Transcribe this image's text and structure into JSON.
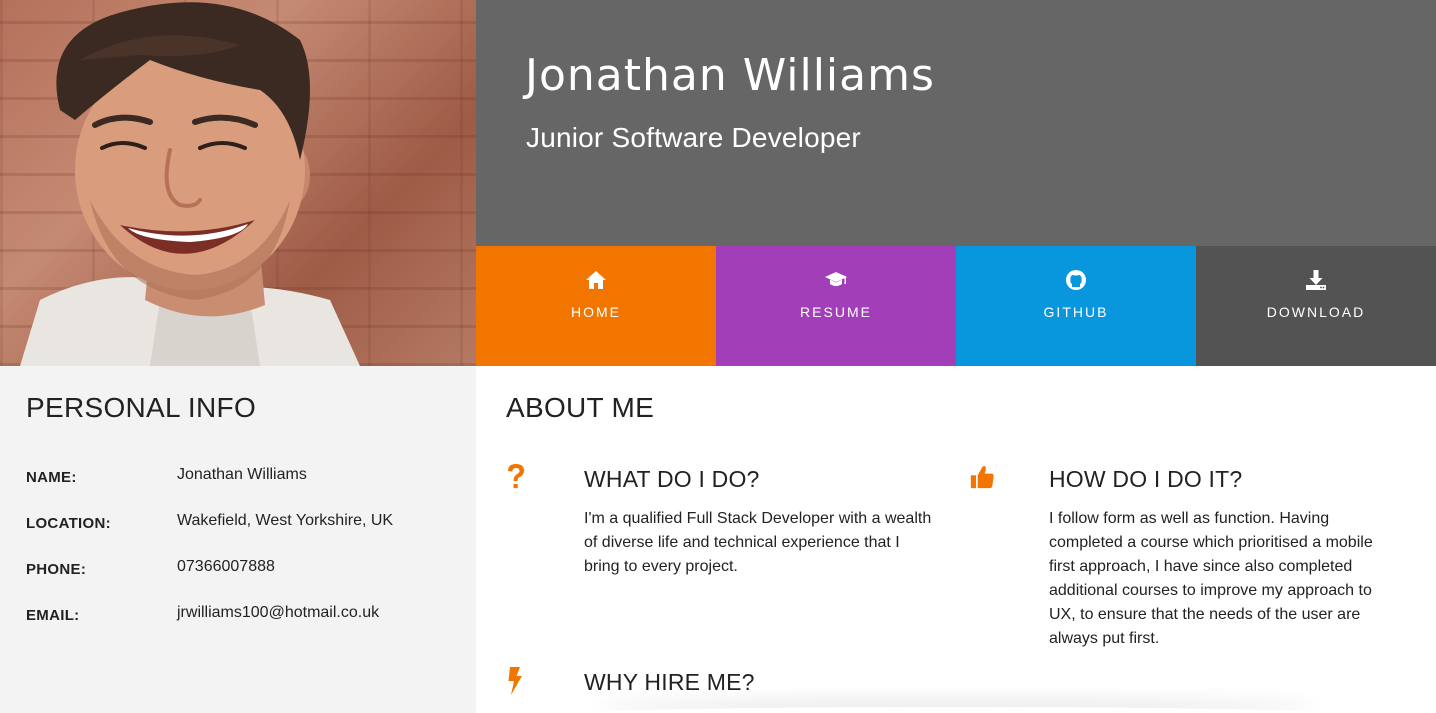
{
  "hero": {
    "name": "Jonathan Williams",
    "title": "Junior Software Developer"
  },
  "nav": [
    {
      "label": "HOME",
      "icon": "home-icon",
      "color": "#f27500"
    },
    {
      "label": "RESUME",
      "icon": "graduation-cap-icon",
      "color": "#a23fb8"
    },
    {
      "label": "GITHUB",
      "icon": "github-icon",
      "color": "#0896dd"
    },
    {
      "label": "DOWNLOAD",
      "icon": "download-icon",
      "color": "#535353"
    }
  ],
  "personal_info": {
    "heading": "PERSONAL INFO",
    "rows": [
      {
        "key": "NAME:",
        "value": "Jonathan Williams"
      },
      {
        "key": "LOCATION:",
        "value": "Wakefield, West Yorkshire, UK"
      },
      {
        "key": "PHONE:",
        "value": "07366007888"
      },
      {
        "key": "EMAIL:",
        "value": "jrwilliams100@hotmail.co.uk"
      }
    ]
  },
  "about": {
    "heading": "ABOUT ME",
    "accent_color": "#f27500",
    "features": [
      {
        "icon": "question-icon",
        "title": "WHAT DO I DO?",
        "lines": [
          "I'm a qualified Full Stack Developer with a wealth",
          "of diverse life and technical experience that I",
          "bring to every project."
        ]
      },
      {
        "icon": "thumbs-up-icon",
        "title": "HOW DO I DO IT?",
        "lines": [
          "I follow form as well as function. Having",
          "completed a course which prioritised a mobile",
          "first approach, I have since also completed",
          "additional courses to improve my approach to",
          "UX, to ensure that the needs of the user are",
          "always put first."
        ]
      },
      {
        "icon": "bolt-icon",
        "title": "WHY HIRE ME?"
      }
    ]
  }
}
